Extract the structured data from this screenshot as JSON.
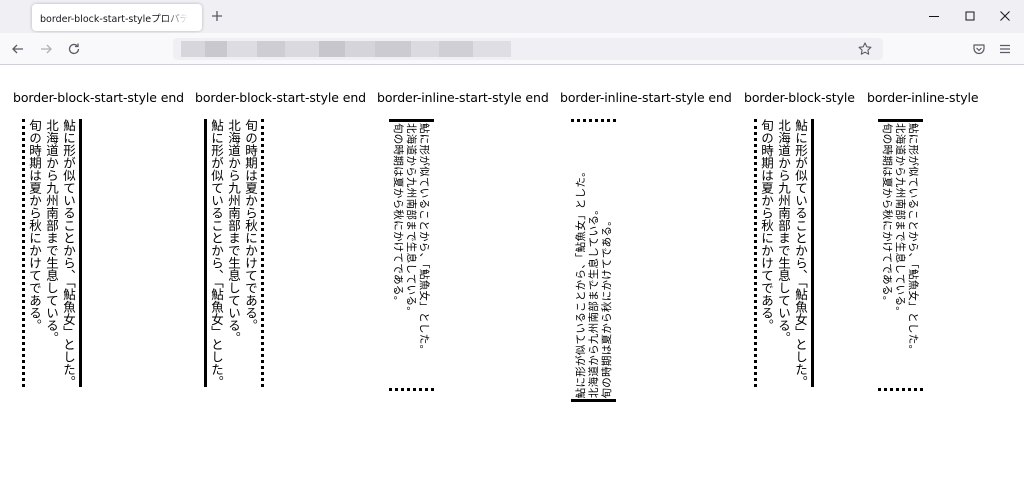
{
  "browser": {
    "tab_title": "border-block-start-styleプロパティ, bo",
    "url_blurred": true
  },
  "columns": [
    {
      "label": "border-block-start-style end",
      "lines": [
        "鮎に形が似ていることから、「鮎魚女」とした。",
        "北海道から九州南部まで生息している。",
        "旬の時期は夏から秋にかけてである。"
      ]
    },
    {
      "label": "border-block-start-style end",
      "lines": [
        "旬の時期は夏から秋にかけてである。",
        "北海道から九州南部まで生息している。",
        "鮎に形が似ていることから、「鮎魚女」とした。"
      ]
    },
    {
      "label": "border-inline-start-style end",
      "lines": [
        "鮎に形が似ていることから、「鮎魚女」とした。",
        "北海道から九州南部まで生息している。",
        "旬の時期は夏から秋にかけてである。"
      ]
    },
    {
      "label": "border-inline-start-style end",
      "lines": [
        "鮎に形が似ていることから、「鮎魚女」とした。",
        "北海道から九州南部まで生息している。",
        "旬の時期は夏から秋にかけてである。"
      ]
    },
    {
      "label": "border-block-style",
      "lines": [
        "鮎に形が似ていることから、「鮎魚女」とした。",
        "北海道から九州南部まで生息している。",
        "旬の時期は夏から秋にかけてである。"
      ]
    },
    {
      "label": "border-inline-style",
      "lines": [
        "鮎に形が似ていることから、「鮎魚女」とした。",
        "北海道から九州南部まで生息している。",
        "旬の時期は夏から秋にかけてである。"
      ]
    }
  ],
  "colors": {
    "tabbar_bg": "#f0f0f4",
    "navbar_bg": "#f9f9fb",
    "urlbar_bg": "#f0f0f4",
    "border": "#000000",
    "icon": "#5b5b66"
  },
  "icons": {
    "tab_close": "close-icon",
    "new_tab": "plus-icon",
    "minimize": "minimize-icon",
    "maximize": "maximize-icon",
    "close_window": "close-window-icon",
    "back": "back-arrow-icon",
    "forward": "forward-arrow-icon",
    "reload": "reload-icon",
    "bookmark": "star-icon",
    "pocket": "pocket-icon",
    "menu": "hamburger-menu-icon"
  }
}
